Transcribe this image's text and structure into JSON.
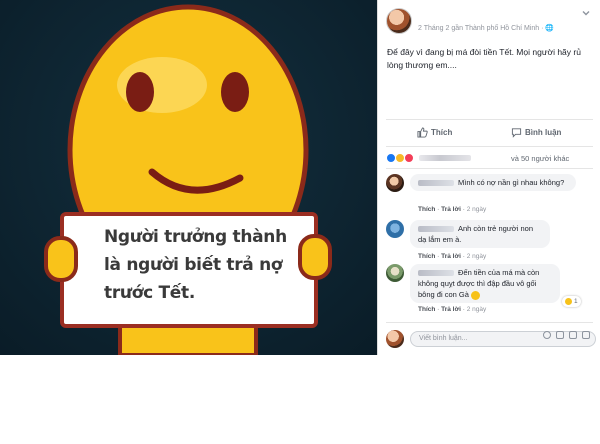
{
  "photo": {
    "sign_lines": [
      "Người trưởng thành",
      "là người biết trả nợ",
      "trước Tết."
    ],
    "colors": {
      "face": "#f9c31a",
      "face_shade": "#f0a90e",
      "outline": "#8b2a1a",
      "sign_border": "#9b2e22",
      "background": "#0e2431"
    }
  },
  "post": {
    "meta": "2 Tháng 2 gần Thành phố Hồ Chí Minh · 🌐",
    "menu_icon": "chevron-down-icon",
    "text": "Để đây vì đang bị má đòi tiền Tết. Mọi người hãy rủ lòng thương em....",
    "actions": {
      "like": "Thích",
      "comment": "Bình luận"
    },
    "reactions_suffix": "và 50 người khác"
  },
  "comments": [
    {
      "text": "Mình có nợ nần gì nhau không?",
      "like": "Thích",
      "reply": "Trả lời",
      "time": "2 ngày"
    },
    {
      "text": "Anh còn trẻ người non dạ lắm em à.",
      "like": "Thích",
      "reply": "Trả lời",
      "time": "2 ngày"
    },
    {
      "text": "Đến tiền của má mà còn không quỵt được thì đập đầu vô gối bông đi con Gà",
      "like": "Thích",
      "reply": "Trả lời",
      "time": "2 ngày",
      "reaction_count": "1"
    }
  ],
  "composer": {
    "placeholder": "Viết bình luận..."
  }
}
